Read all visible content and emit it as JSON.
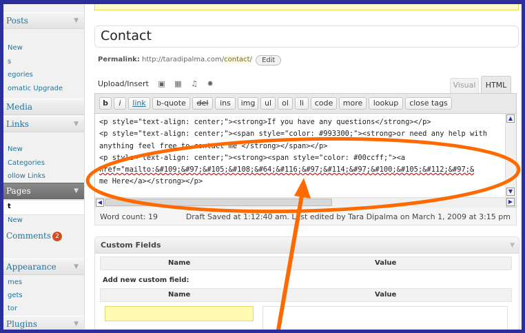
{
  "sidebar": {
    "posts_label": "Posts",
    "posts_sub": [
      "New",
      "s",
      "egories",
      "omatic Upgrade"
    ],
    "media_label": "Media",
    "links_label": "Links",
    "links_sub": [
      "New",
      "Categories",
      "ollow Links"
    ],
    "pages_label": "Pages",
    "pages_sub": [
      "t",
      "New"
    ],
    "comments_label": "Comments",
    "comments_count": "2",
    "appearance_label": "Appearance",
    "appearance_sub": [
      "mes",
      "gets",
      "tor"
    ],
    "plugins_label": "Plugins"
  },
  "page": {
    "title": "Contact",
    "permalink_label": "Permalink:",
    "permalink_base": "http://taradipalma.com/",
    "permalink_slug": "contact",
    "permalink_end": "/",
    "edit_label": "Edit"
  },
  "editor": {
    "upload_label": "Upload/Insert",
    "tab_visual": "Visual",
    "tab_html": "HTML",
    "buttons": [
      "b",
      "i",
      "link",
      "b-quote",
      "del",
      "ins",
      "img",
      "ul",
      "ol",
      "li",
      "code",
      "more",
      "lookup",
      "close tags"
    ],
    "lines": [
      "<p style=\"text-align: center;\"><strong>If you have any questions</strong></p>",
      "<p style=\"text-align: center;\"><span style=\"color: #993300;\"><strong>or need any help with",
      "anything feel free to contact me </strong></span></p>",
      "<p style=\"text-align: center;\"><strong><span style=\"color: #00ccff;\"><a",
      "href=\"mailto:&#109;&#97;&#105;&#108;&#64;&#116;&#97;&#114;&#97;&#100;&#105;&#112;&#97;&",
      "me Here</a></strong></p>"
    ]
  },
  "status": {
    "word_count": "Word count: 19",
    "saved": "Draft Saved at 1:12:40 am. Last edited by Tara Dipalma on March 1, 2009 at 3:15 pm"
  },
  "custom_fields": {
    "title": "Custom Fields",
    "col_name": "Name",
    "col_value": "Value",
    "add_label": "Add new custom field:"
  },
  "colors": {
    "frame": "#2a2f9c",
    "annotation": "#ff6a00",
    "link": "#21759b"
  }
}
